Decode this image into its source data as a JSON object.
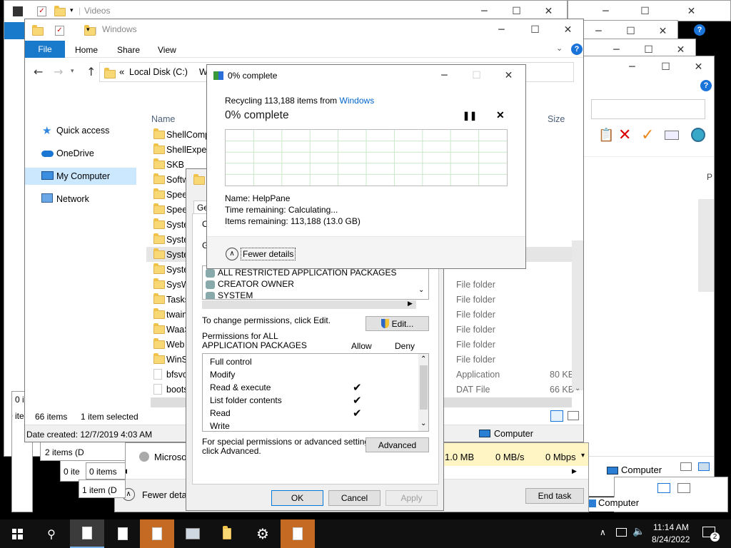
{
  "videos_window": {
    "title": "Videos"
  },
  "explorer": {
    "title": "Windows",
    "ribbon_tabs": [
      "File",
      "Home",
      "Share",
      "View"
    ],
    "address": {
      "prefix": "«",
      "path": "Local Disk (C:)",
      "next": "W"
    },
    "nav": {
      "quick_access": "Quick access",
      "onedrive": "OneDrive",
      "my_computer": "My Computer",
      "network": "Network"
    },
    "column_name": "Name",
    "column_size": "Size",
    "files": [
      "ShellComp",
      "ShellExperi",
      "SKB",
      "Softw",
      "Speec",
      "Speec",
      "Syster",
      "Syster",
      "Syster",
      "Syster",
      "SysW",
      "Tasks",
      "twain",
      "WaaS",
      "Web",
      "WinS",
      "bfsvc",
      "boots"
    ],
    "types": [
      "File folder",
      "File folder",
      "File folder",
      "File folder",
      "File folder",
      "File folder",
      "Application",
      "DAT File"
    ],
    "sizes": [
      "80 KB",
      "66 KB"
    ],
    "status_items": "66 items",
    "status_selected": "1 item selected",
    "date_created": "Date created: 12/7/2019 4:03 AM",
    "computer_label": "Computer",
    "left_count_1": "0 i",
    "left_count_2": "0 ite"
  },
  "right_windows": {
    "computer_a": "Computer",
    "computer_b": "Computer"
  },
  "task_manager": {
    "row_label": "Microsof",
    "mem": "1.0 MB",
    "disk": "0 MB/s",
    "net": "0 Mbps",
    "fewer_details": "Fewer detail",
    "end_task": "End task",
    "items_a": "2 items (D",
    "items_b": "0 items",
    "items_c": "0 ite",
    "items_d": "1 item (D"
  },
  "security": {
    "tab_partial": "Ge",
    "obj_partial": "O",
    "group_partial": "G",
    "principals": [
      "ALL RESTRICTED APPLICATION PACKAGES",
      "CREATOR OWNER",
      "SYSTEM"
    ],
    "change_text": "To change permissions, click Edit.",
    "edit_label": "Edit...",
    "perms_for": "Permissions for ALL\nAPPLICATION PACKAGES",
    "allow": "Allow",
    "deny": "Deny",
    "perms": [
      {
        "name": "Full control",
        "allow": false
      },
      {
        "name": "Modify",
        "allow": false
      },
      {
        "name": "Read & execute",
        "allow": true
      },
      {
        "name": "List folder contents",
        "allow": true
      },
      {
        "name": "Read",
        "allow": true
      },
      {
        "name": "Write",
        "allow": false
      }
    ],
    "special_text": "For special permissions or advanced settings,\nclick Advanced.",
    "advanced_label": "Advanced",
    "ok": "OK",
    "cancel": "Cancel",
    "apply": "Apply"
  },
  "progress": {
    "title": "0% complete",
    "recycling_prefix": "Recycling 113,188 items from ",
    "recycling_link": "Windows",
    "heading": "0% complete",
    "percent": 0,
    "name": "Name:  HelpPane",
    "time": "Time remaining:  Calculating...",
    "items": "Items remaining:  113,188 (13.0 GB)",
    "fewer": "Fewer details"
  },
  "taskbar": {
    "time": "11:14 AM",
    "date": "8/24/2022",
    "notif_count": "2"
  },
  "colors": {
    "accent": "#0078d7",
    "ribbon_file": "#1979ca",
    "taskbar": "#101010",
    "highlight_yellow": "#fff4c4"
  }
}
